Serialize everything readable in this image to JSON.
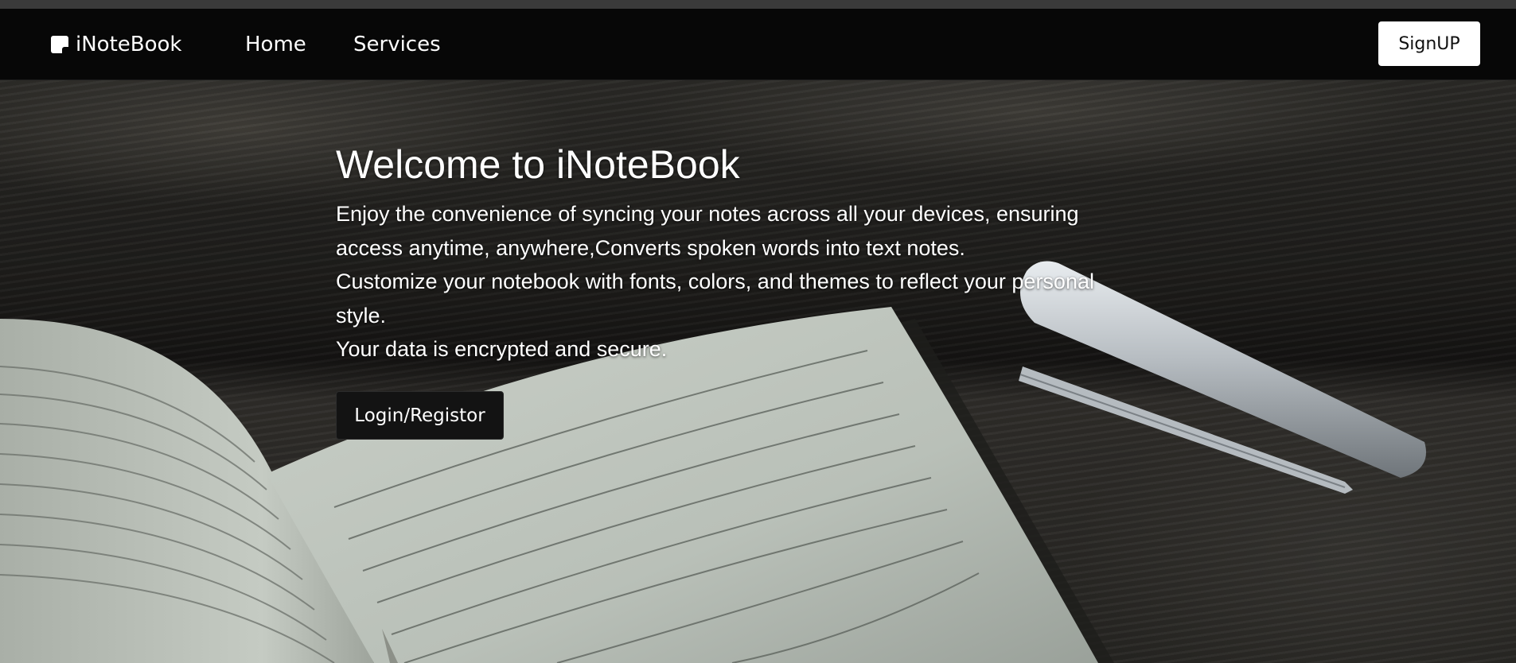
{
  "navbar": {
    "brand_icon": "sticky-note-icon",
    "brand": "iNoteBook",
    "links": [
      "Home",
      "Services"
    ],
    "signup_label": "SignUP"
  },
  "hero": {
    "title": "Welcome to iNoteBook",
    "paragraphs": [
      "Enjoy the convenience of syncing your notes across all your devices, ensuring access anytime, anywhere,Converts spoken words into text notes.",
      "Customize your notebook with fonts, colors, and themes to reflect your personal style.",
      "Your data is encrypted and secure."
    ],
    "cta_label": "Login/Registor",
    "background_image": "open notebook and pen on wooden table"
  },
  "colors": {
    "navbar_bg": "#070707",
    "primary_text": "#ffffff",
    "button_dark": "#131313",
    "button_light": "#ffffff"
  }
}
